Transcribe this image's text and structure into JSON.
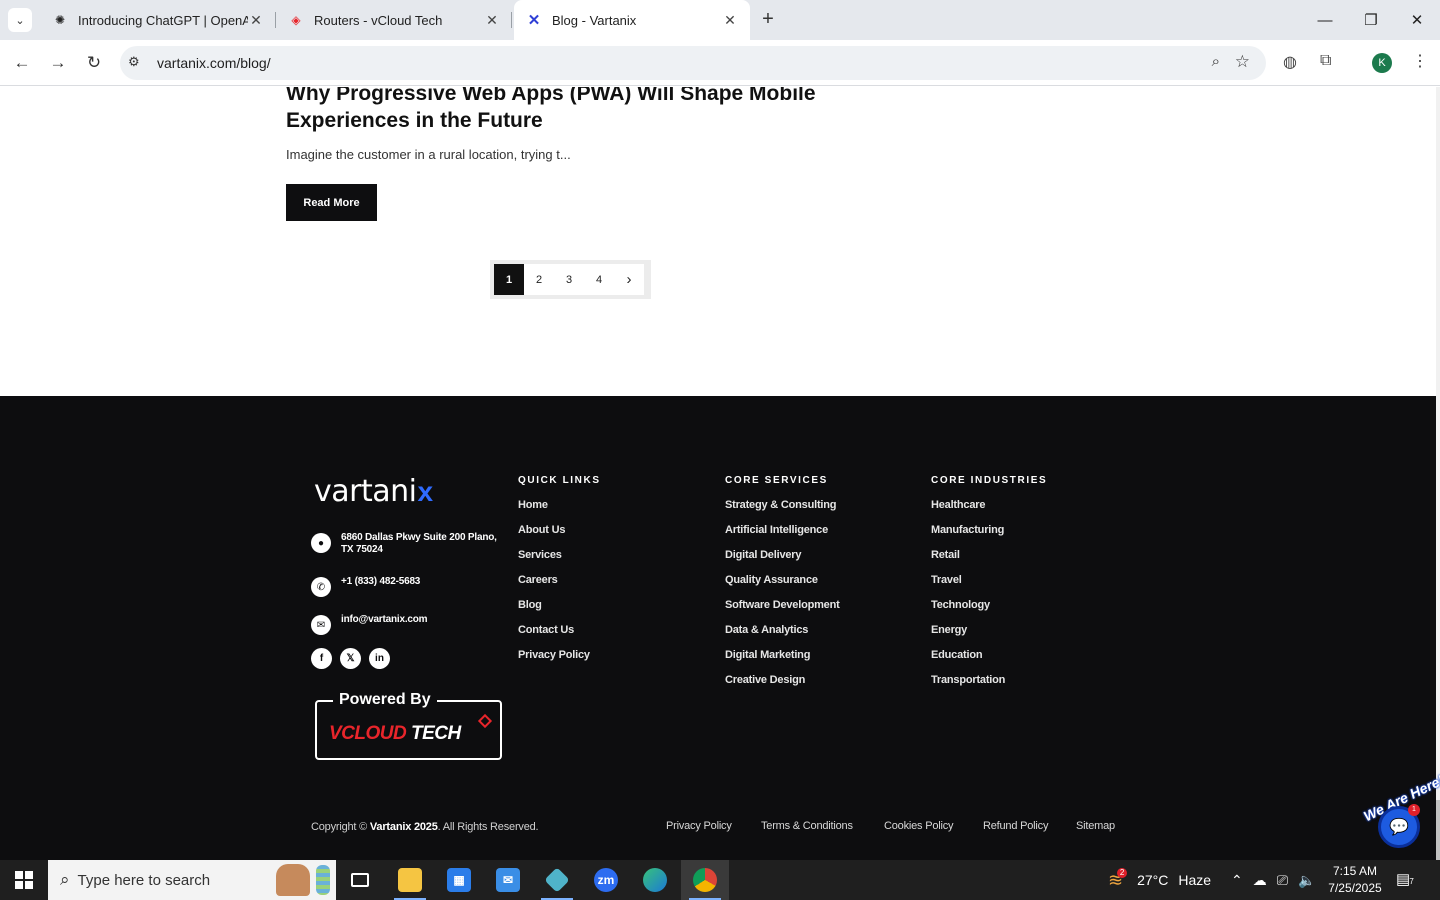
{
  "browser": {
    "tabs": [
      {
        "title": "Introducing ChatGPT | OpenAI",
        "icon": "openai-icon",
        "active": false
      },
      {
        "title": "Routers - vCloud Tech",
        "icon": "vcloud-tag-icon",
        "active": false
      },
      {
        "title": "Blog - Vartanix",
        "icon": "vartanix-x-icon",
        "active": true
      }
    ],
    "url": "vartanix.com/blog/",
    "profile_initial": "K"
  },
  "post": {
    "title": "Why Progressive Web Apps (PWA) Will Shape Mobile Experiences in the Future",
    "excerpt": "Imagine the customer in a rural location, trying t...",
    "read_more_label": "Read More"
  },
  "pagination": {
    "pages": [
      "1",
      "2",
      "3",
      "4"
    ],
    "current": "1",
    "next_symbol": "›"
  },
  "footer": {
    "logo_text": "vartani",
    "logo_accent": "x",
    "accent_color": "#2f6bff",
    "address": "6860 Dallas Pkwy Suite 200 Plano, TX 75024",
    "phone": "+1 (833) 482-5683",
    "email": "info@vartanix.com",
    "socials": [
      "facebook-icon",
      "x-twitter-icon",
      "linkedin-icon"
    ],
    "powered_by_label": "Powered By",
    "powered_brand_red": "VCLOUD",
    "powered_brand_white": "TECH",
    "quick_links": {
      "heading": "QUICK LINKS",
      "items": [
        "Home",
        "About Us",
        "Services",
        "Careers",
        "Blog",
        "Contact Us",
        "Privacy Policy"
      ]
    },
    "core_services": {
      "heading": "CORE SERVICES",
      "items": [
        "Strategy & Consulting",
        "Artificial Intelligence",
        "Digital Delivery",
        "Quality Assurance",
        "Software Development",
        "Data & Analytics",
        "Digital Marketing",
        "Creative Design"
      ]
    },
    "core_industries": {
      "heading": "CORE INDUSTRIES",
      "items": [
        "Healthcare",
        "Manufacturing",
        "Retail",
        "Travel",
        "Technology",
        "Energy",
        "Education",
        "Transportation"
      ]
    },
    "copyright_prefix": "Copyright © ",
    "copyright_brand": "Vartanix 2025",
    "copyright_suffix": ". All Rights Reserved.",
    "legal_links": [
      "Privacy Policy",
      "Terms & Conditions",
      "Cookies Policy",
      "Refund Policy",
      "Sitemap"
    ]
  },
  "chat_widget": {
    "banner": "We Are Here!",
    "badge_count": "1"
  },
  "taskbar": {
    "search_placeholder": "Type here to search",
    "weather_temp": "27°C",
    "weather_desc": "Haze",
    "weather_badge": "2",
    "time": "7:15 AM",
    "date": "7/25/2025",
    "notification_count": "7"
  }
}
